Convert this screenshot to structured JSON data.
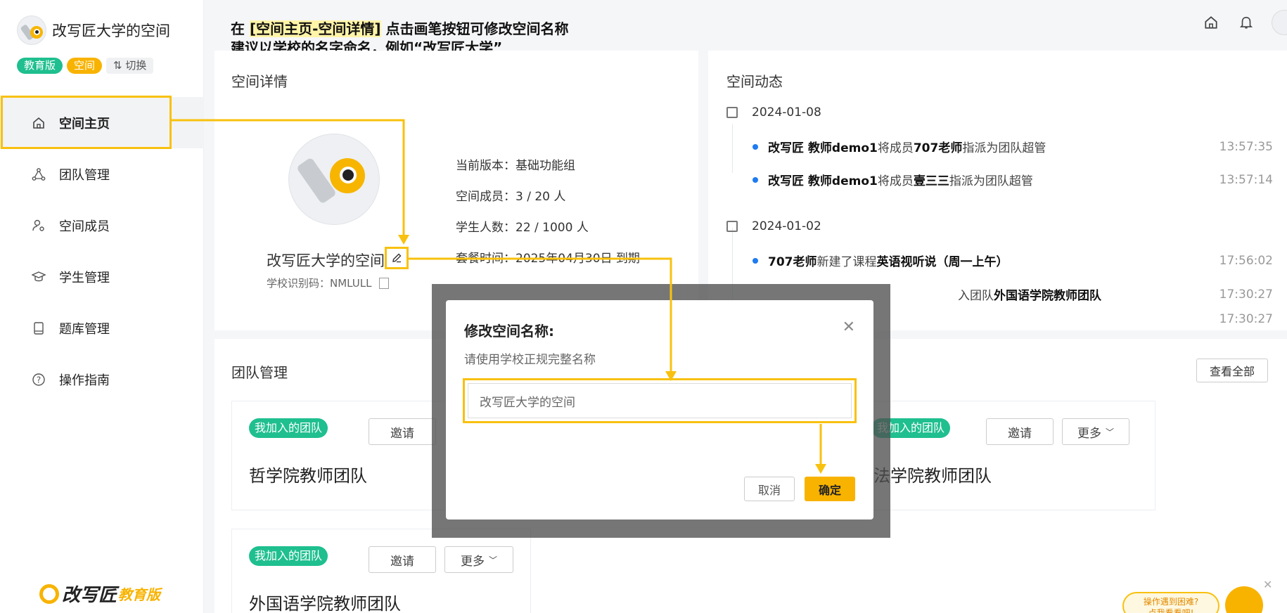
{
  "instruction": {
    "prefix": "在 ",
    "highlight": "[空间主页-空间详情]",
    "suffix": " 点击画笔按钮可修改空间名称",
    "line2": "建议以学校的名字命名，例如“改写匠大学”"
  },
  "sidebar": {
    "brand_name": "改写匠大学的空间",
    "tags": {
      "edition": "教育版",
      "space": "空间",
      "switch": "⇅ 切换"
    },
    "items": [
      {
        "label": "空间主页",
        "icon": "home-icon"
      },
      {
        "label": "团队管理",
        "icon": "team-icon"
      },
      {
        "label": "空间成员",
        "icon": "member-settings-icon"
      },
      {
        "label": "学生管理",
        "icon": "graduation-cap-icon"
      },
      {
        "label": "题库管理",
        "icon": "book-icon"
      },
      {
        "label": "操作指南",
        "icon": "help-icon"
      }
    ],
    "footer_logo": "改写匠",
    "footer_edu": "教育版"
  },
  "detail": {
    "title": "空间详情",
    "space_name": "改写匠大学的空间",
    "school_code": "学校识别码：NMLULL",
    "info": [
      "当前版本：基础功能组",
      "空间成员：3 / 20 人",
      "学生人数：22 / 1000 人",
      "套餐时间：2025年04月30日 到期"
    ]
  },
  "feed": {
    "title": "空间动态",
    "dates": [
      "2024-01-08",
      "2024-01-02"
    ],
    "rows": [
      {
        "actor": "改写匠 教师demo1",
        "action": " 将成员 ",
        "target": "707老师",
        "rest": " 指派为团队超管",
        "time": "13:57:35"
      },
      {
        "actor": "改写匠 教师demo1",
        "action": " 将成员 ",
        "target": "壹三三",
        "rest": " 指派为团队超管",
        "time": "13:57:14"
      },
      {
        "actor": "707老师",
        "action": " 新建了课程 ",
        "target": "英语视听说（周一上午）",
        "rest": "",
        "time": "17:56:02"
      },
      {
        "actor": "",
        "action": "入团队 ",
        "target": "外国语学院教师团队",
        "rest": "",
        "time": "17:30:27"
      },
      {
        "actor": "",
        "action": "",
        "target": "",
        "rest": "",
        "time": "17:30:27"
      }
    ]
  },
  "team": {
    "title": "团队管理",
    "view_all": "查看全部",
    "badge": "我加入的团队",
    "invite": "邀请",
    "more": "更多",
    "cards": [
      {
        "name": "哲学院教师团队"
      },
      {
        "name": "法学院教师团队"
      },
      {
        "name": "外国语学院教师团队"
      }
    ]
  },
  "modal": {
    "title": "修改空间名称:",
    "subtitle": "请使用学校正规完整名称",
    "input_value": "改写匠大学的空间",
    "cancel": "取消",
    "ok": "确定"
  },
  "help": {
    "line1": "操作遇到困难?",
    "line2": "点我看看吧!"
  },
  "colors": {
    "accent": "#f8b300",
    "green": "#1fbf8f",
    "annotation": "#f8c10f",
    "dot": "#1e7bf2"
  }
}
